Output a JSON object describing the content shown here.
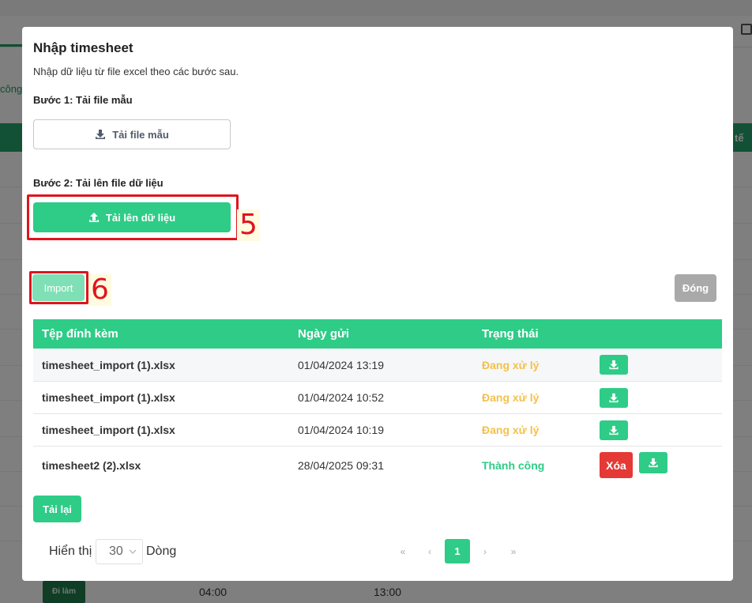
{
  "modal": {
    "title": "Nhập timesheet",
    "description": "Nhập dữ liệu từ file excel theo các bước sau.",
    "step1_label": "Bước 1: Tải file mẫu",
    "download_template_label": "Tải file mẫu",
    "step2_label": "Bước 2: Tải lên file dữ liệu",
    "upload_label": "Tải lên dữ liệu",
    "import_label": "Import",
    "close_label": "Đóng",
    "reload_label": "Tải lại"
  },
  "annotations": {
    "five": "5",
    "six": "6"
  },
  "table": {
    "headers": [
      "Tệp đính kèm",
      "Ngày gửi",
      "Trạng thái"
    ],
    "rows": [
      {
        "file": "timesheet_import (1).xlsx",
        "date": "01/04/2024 13:19",
        "status": "Đang xử lý"
      },
      {
        "file": "timesheet_import (1).xlsx",
        "date": "01/04/2024 10:52",
        "status": "Đang xử lý"
      },
      {
        "file": "timesheet_import (1).xlsx",
        "date": "01/04/2024 10:19",
        "status": "Đang xử lý"
      },
      {
        "file": "timesheet2 (2).xlsx",
        "date": "28/04/2025 09:31",
        "status": "Thành công",
        "delete_label": "Xóa"
      }
    ]
  },
  "pagination": {
    "show_label": "Hiển thị",
    "page_size": "30",
    "rows_label": "Dòng",
    "first": "«",
    "prev": "‹",
    "current_page": "1",
    "next": "›",
    "last": "»"
  },
  "background": {
    "cong_text": "công",
    "te_text": "tế",
    "di_lam": "Đi làm",
    "time_start": "04:00",
    "time_end": "13:00"
  },
  "colors": {
    "primary": "#2ecc87",
    "pending": "#f4c04a",
    "danger": "#e53935",
    "annotation": "#e0141e"
  }
}
